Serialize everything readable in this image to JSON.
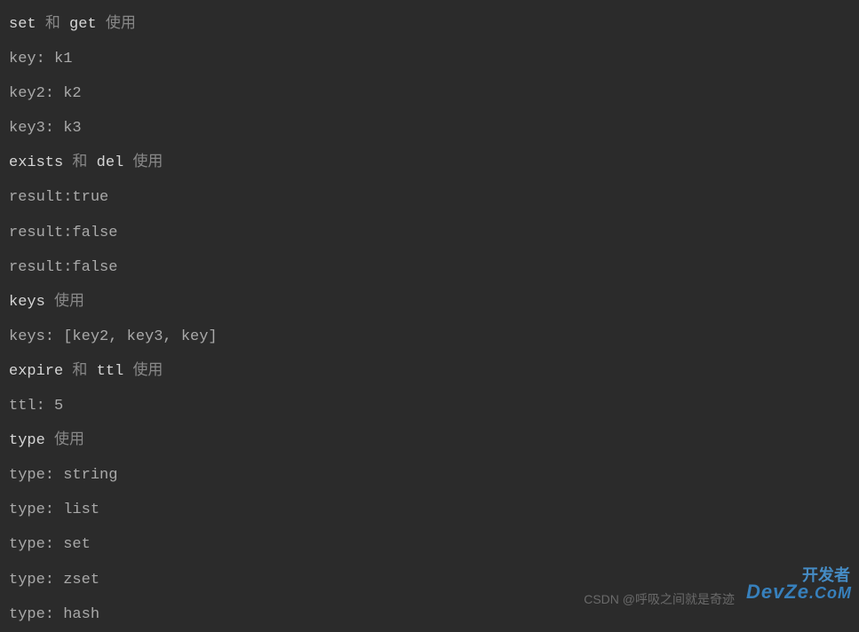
{
  "lines": [
    {
      "segments": [
        {
          "text": "set",
          "class": "highlight"
        },
        {
          "text": " ",
          "class": ""
        },
        {
          "text": "和",
          "class": "cjk"
        },
        {
          "text": " ",
          "class": ""
        },
        {
          "text": "get",
          "class": "highlight"
        },
        {
          "text": " ",
          "class": ""
        },
        {
          "text": "使用",
          "class": "cjk"
        }
      ]
    },
    {
      "segments": [
        {
          "text": "key: k1",
          "class": ""
        }
      ]
    },
    {
      "segments": [
        {
          "text": "key2: k2",
          "class": ""
        }
      ]
    },
    {
      "segments": [
        {
          "text": "key3: k3",
          "class": ""
        }
      ]
    },
    {
      "segments": [
        {
          "text": "exists",
          "class": "highlight"
        },
        {
          "text": " ",
          "class": ""
        },
        {
          "text": "和",
          "class": "cjk"
        },
        {
          "text": " ",
          "class": ""
        },
        {
          "text": "del",
          "class": "highlight"
        },
        {
          "text": " ",
          "class": ""
        },
        {
          "text": "使用",
          "class": "cjk"
        }
      ]
    },
    {
      "segments": [
        {
          "text": "result:true",
          "class": ""
        }
      ]
    },
    {
      "segments": [
        {
          "text": "result:false",
          "class": ""
        }
      ]
    },
    {
      "segments": [
        {
          "text": "result:false",
          "class": ""
        }
      ]
    },
    {
      "segments": [
        {
          "text": "keys",
          "class": "highlight"
        },
        {
          "text": " ",
          "class": ""
        },
        {
          "text": "使用",
          "class": "cjk"
        }
      ]
    },
    {
      "segments": [
        {
          "text": "keys: [key2, key3, key]",
          "class": ""
        }
      ]
    },
    {
      "segments": [
        {
          "text": "expire",
          "class": "highlight"
        },
        {
          "text": " ",
          "class": ""
        },
        {
          "text": "和",
          "class": "cjk"
        },
        {
          "text": " ",
          "class": ""
        },
        {
          "text": "ttl",
          "class": "highlight"
        },
        {
          "text": " ",
          "class": ""
        },
        {
          "text": "使用",
          "class": "cjk"
        }
      ]
    },
    {
      "segments": [
        {
          "text": "ttl: 5",
          "class": ""
        }
      ]
    },
    {
      "segments": [
        {
          "text": "type",
          "class": "highlight"
        },
        {
          "text": " ",
          "class": ""
        },
        {
          "text": "使用",
          "class": "cjk"
        }
      ]
    },
    {
      "segments": [
        {
          "text": "type: string",
          "class": ""
        }
      ]
    },
    {
      "segments": [
        {
          "text": "type: list",
          "class": ""
        }
      ]
    },
    {
      "segments": [
        {
          "text": "type: set",
          "class": ""
        }
      ]
    },
    {
      "segments": [
        {
          "text": "type: zset",
          "class": ""
        }
      ]
    },
    {
      "segments": [
        {
          "text": "type: hash",
          "class": ""
        }
      ]
    }
  ],
  "watermark": {
    "csdn": "CSDN @呼吸之间就是奇迹",
    "top": "开发者",
    "devze_main": "DevZe",
    "devze_sub": ".CoM"
  }
}
